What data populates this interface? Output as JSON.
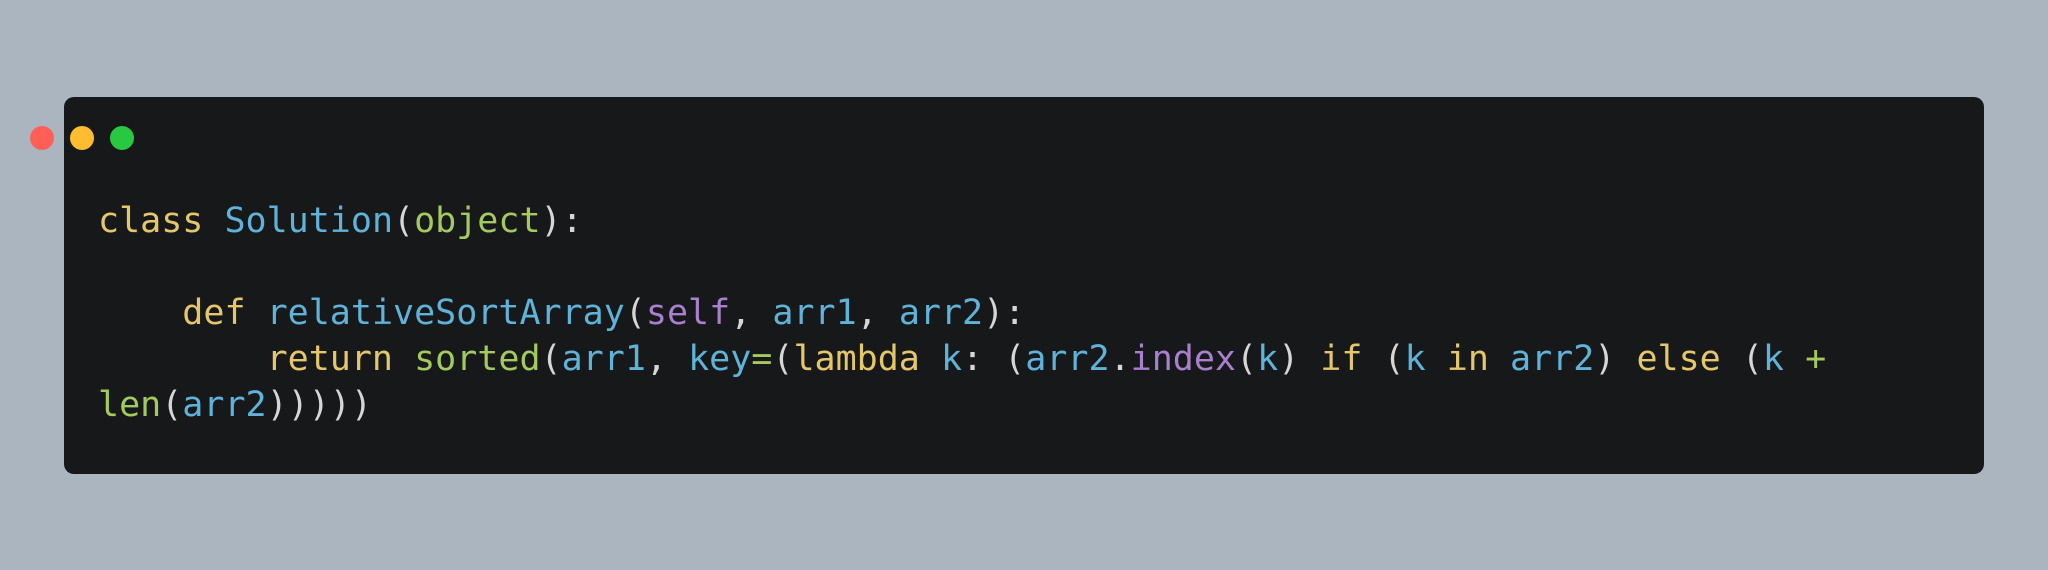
{
  "window": {
    "colors": {
      "background": "#abb5c0",
      "editor": "#17181a",
      "red": "#ff5f57",
      "yellow": "#febc2e",
      "green": "#28c840"
    }
  },
  "code": {
    "line1": {
      "t1": "class",
      "t2": " ",
      "t3": "Solution",
      "t4": "(",
      "t5": "object",
      "t6": "):"
    },
    "line3": {
      "t1": "    ",
      "t2": "def",
      "t3": " ",
      "t4": "relativeSortArray",
      "t5": "(",
      "t6": "self",
      "t7": ", ",
      "t8": "arr1",
      "t9": ", ",
      "t10": "arr2",
      "t11": "):"
    },
    "line4": {
      "t1": "        ",
      "t2": "return",
      "t3": " ",
      "t4": "sorted",
      "t5": "(",
      "t6": "arr1",
      "t7": ", ",
      "t8": "key",
      "t9": "=",
      "t10": "(",
      "t11": "lambda",
      "t12": " ",
      "t13": "k",
      "t14": ": (",
      "t15": "arr2",
      "t16": ".",
      "t17": "index",
      "t18": "(",
      "t19": "k",
      "t20": ") ",
      "t21": "if",
      "t22": " (",
      "t23": "k",
      "t24": " ",
      "t25": "in",
      "t26": " ",
      "t27": "arr2",
      "t28": ") ",
      "t29": "else",
      "t30": " (",
      "t31": "k",
      "t32": " ",
      "t33": "+"
    },
    "line5": {
      "t1": "len",
      "t2": "(",
      "t3": "arr2",
      "t4": ")))))"
    }
  }
}
